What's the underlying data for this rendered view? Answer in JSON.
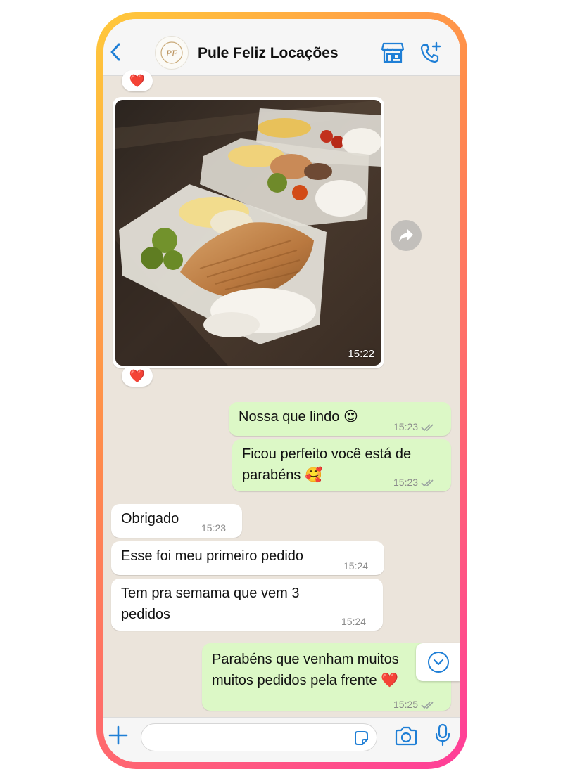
{
  "header": {
    "title": "Pule Feliz Locações",
    "avatar_initials": "PF"
  },
  "messages": [
    {
      "direction": "in",
      "type": "image",
      "time": "15:22",
      "reaction": "❤️"
    },
    {
      "direction": "out",
      "text": "Nossa que lindo 😍",
      "time": "15:23",
      "status": "read"
    },
    {
      "direction": "out",
      "text_line1": "Ficou perfeito você está de",
      "text_line2": "parabéns 🥰",
      "time": "15:23",
      "status": "read"
    },
    {
      "direction": "in",
      "text": "Obrigado",
      "time": "15:23"
    },
    {
      "direction": "in",
      "text": "Esse foi meu primeiro pedido",
      "time": "15:24"
    },
    {
      "direction": "in",
      "text_line1": "Tem pra semama que vem 3",
      "text_line2": "pedidos",
      "time": "15:24"
    },
    {
      "direction": "out",
      "text_line1": "Parabéns que venham muitos",
      "text_line2": "muitos pedidos pela frente ❤️",
      "time": "15:25",
      "status": "read"
    }
  ],
  "top_reaction": "❤️",
  "input": {
    "placeholder": ""
  },
  "colors": {
    "accent": "#1f7fd6",
    "outgoing_bubble": "#dcf8c6",
    "incoming_bubble": "#ffffff",
    "frame_gradient_start": "#ffc93a",
    "frame_gradient_end": "#ff3d9a"
  },
  "icons": {
    "back": "chevron-left-icon",
    "header_left": "store-icon",
    "header_right": "phone-plus-icon",
    "forward": "forward-arrow-icon",
    "scroll": "chevron-down-circle-icon",
    "attach": "plus-icon",
    "sticker": "sticker-icon",
    "camera": "camera-icon",
    "mic": "microphone-icon"
  }
}
